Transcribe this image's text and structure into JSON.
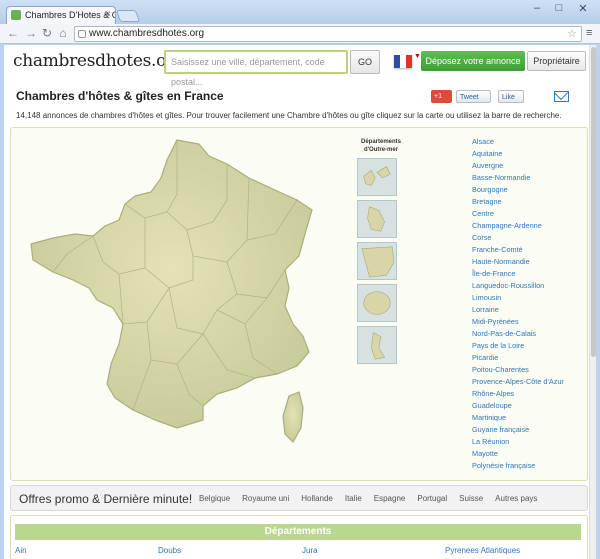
{
  "browser": {
    "tab_title": "Chambres D'Hotes & Gîtes",
    "url": "www.chambresdhotes.org",
    "controls": [
      "–",
      "□",
      "✕"
    ]
  },
  "header": {
    "logo": "chambresdhotes.org",
    "search_placeholder": "Saisissez une ville, département, code postal...",
    "search_button": "GO",
    "post_ad_button": "Déposez votre annonce",
    "owner_button": "Propriétaire",
    "flag_colors": [
      "#2a4fa3",
      "#ffffff",
      "#e0332e"
    ]
  },
  "intro": {
    "title": "Chambres d'hôtes & gîtes en France",
    "gplus": "+1",
    "gplus_count": "",
    "tweet": "Tweet",
    "like": "Like",
    "text": "14,148 annonces de chambres d'hôtes et gîtes. Pour trouver facilement une Chambre d'hôtes ou gîte cliquez sur la carte ou utilisez la barre de recherche."
  },
  "map": {
    "overseas_heading_line1": "Départements",
    "overseas_heading_line2": "d'Outre-mer",
    "regions": [
      "Alsace",
      "Aquitaine",
      "Auvergne",
      "Basse-Normandie",
      "Bourgogne",
      "Bretagne",
      "Centre",
      "Champagne-Ardenne",
      "Corse",
      "Franche-Comté",
      "Haute-Normandie",
      "Île-de-France",
      "Languedoc-Roussillon",
      "Limousin",
      "Lorraine",
      "Midi-Pyrénées",
      "Nord-Pas-de-Calais",
      "Pays de la Loire",
      "Picardie",
      "Poitou-Charentes",
      "Provence-Alpes-Côte d'Azur",
      "Rhône-Alpes",
      "Guadeloupe",
      "Martinique",
      "Guyane française",
      "La Réunion",
      "Mayotte",
      "Polynésie française"
    ]
  },
  "promo": {
    "title": "Offres promo & Dernière minute!",
    "countries": [
      "Belgique",
      "Royaume uni",
      "Hollande",
      "Italie",
      "Espagne",
      "Portugal",
      "Suisse",
      "Autres pays"
    ]
  },
  "departments": {
    "header": "Départements",
    "first_row": [
      "Ain",
      "Doubs",
      "Jura",
      "Pyrenees Atlantiques"
    ]
  },
  "colors": {
    "accent_green": "#3f9e33",
    "link_blue": "#2f76b8",
    "map_fill": "#d9d9a9"
  }
}
